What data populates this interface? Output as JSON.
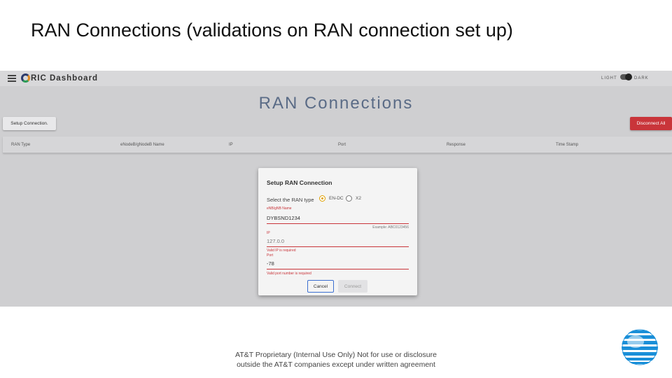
{
  "slide": {
    "title": "RAN Connections (validations on RAN connection set up)",
    "footer_line1": "AT&T Proprietary (Internal Use Only) Not for use or disclosure",
    "footer_line2": "outside the AT&T companies except under written agreement"
  },
  "app": {
    "logo_text": "RIC Dashboard",
    "theme_light": "LIGHT",
    "theme_dark": "DARK"
  },
  "page": {
    "heading": "RAN Connections",
    "setup_button": "Setup Connection.",
    "disconnect_button": "Disconnect All"
  },
  "table": {
    "columns": [
      "RAN Type",
      "eNodeB/gNodeB Name",
      "IP",
      "Port",
      "Response",
      "Time Stamp"
    ]
  },
  "dialog": {
    "title": "Setup RAN Connection",
    "ran_type_label": "Select the RAN type",
    "ran_options": [
      "EN-DC",
      "X2"
    ],
    "selected_option": "EN-DC",
    "name_label": "eNB/gNB Name",
    "name_value": "DYBSND1234",
    "name_hint": "Example: ABC0123456",
    "ip_label": "IP",
    "ip_value": "127.0.0",
    "ip_error": "Valid IP is required",
    "port_label": "Port",
    "port_value": "-78",
    "port_error": "Valid port number is required",
    "cancel_button": "Cancel",
    "connect_button": "Connect"
  },
  "colors": {
    "accent_error": "#c9353a",
    "heading": "#5a6b86",
    "radio_selected": "#e0a000",
    "focus_blue": "#3c6fd0"
  }
}
